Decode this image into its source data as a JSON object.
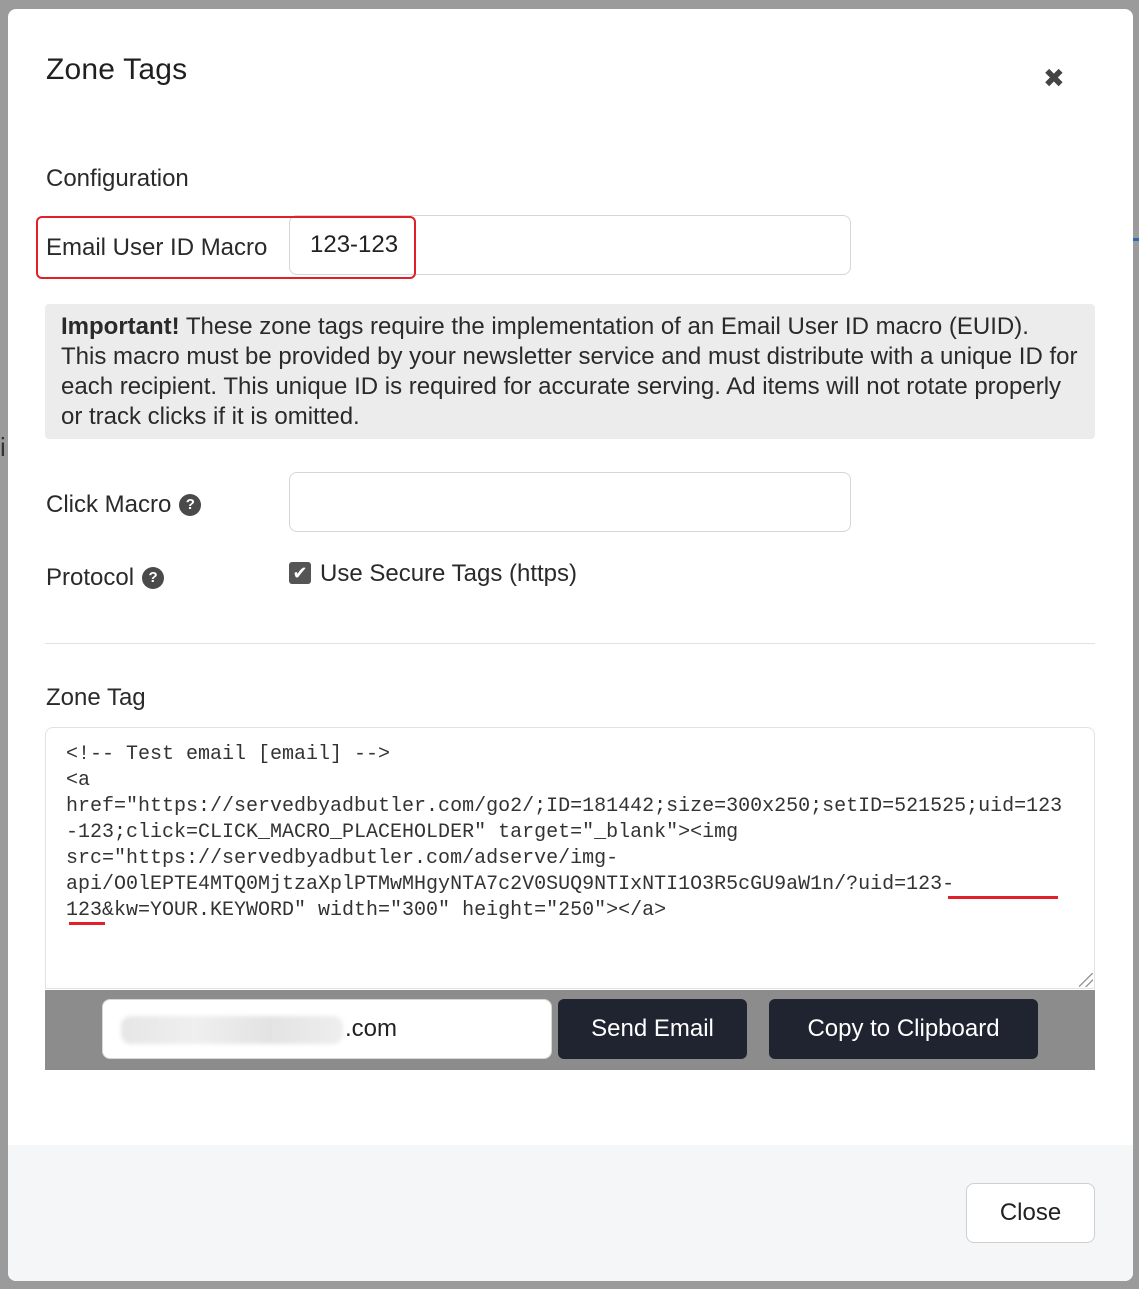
{
  "modal": {
    "title": "Zone Tags",
    "close_icon": "close-icon"
  },
  "configuration": {
    "heading": "Configuration",
    "email_user_id_label": "Email User ID Macro",
    "email_user_id_value": "123-123",
    "notice_bold": "Important!",
    "notice_text": " These zone tags require the implementation of an Email User ID macro (EUID). This macro must be provided by your newsletter service and must distribute with a unique ID for each recipient. This unique ID is required for accurate serving. Ad items will not rotate properly or track clicks if it is omitted.",
    "click_macro_label": "Click Macro",
    "click_macro_value": "",
    "protocol_label": "Protocol",
    "secure_tags_label": "Use Secure Tags (https)",
    "secure_tags_checked": true,
    "help_icon_glyph": "?"
  },
  "zone_tag": {
    "heading": "Zone Tag",
    "code": "<!-- Test email [email] -->\n<a\nhref=\"https://servedbyadbutler.com/go2/;ID=181442;size=300x250;setID=521525;uid=123-123;click=CLICK_MACRO_PLACEHOLDER\" target=\"_blank\"><img\nsrc=\"https://servedbyadbutler.com/adserve/img-\napi/O0lEPTE4MTQ0MjtzaXplPTMwMHgyNTA7c2V0SUQ9NTIxNTI1O3R5cGU9aW1n/?uid=123-\n123&kw=YOUR.KEYWORD\" width=\"300\" height=\"250\"></a>"
  },
  "actions": {
    "email_suffix": ".com",
    "send_email_label": "Send Email",
    "copy_label": "Copy to Clipboard"
  },
  "footer": {
    "close_label": "Close"
  },
  "colors": {
    "highlight": "#e0202a",
    "button_dark": "#1f2430",
    "notice_bg": "#ececec"
  }
}
